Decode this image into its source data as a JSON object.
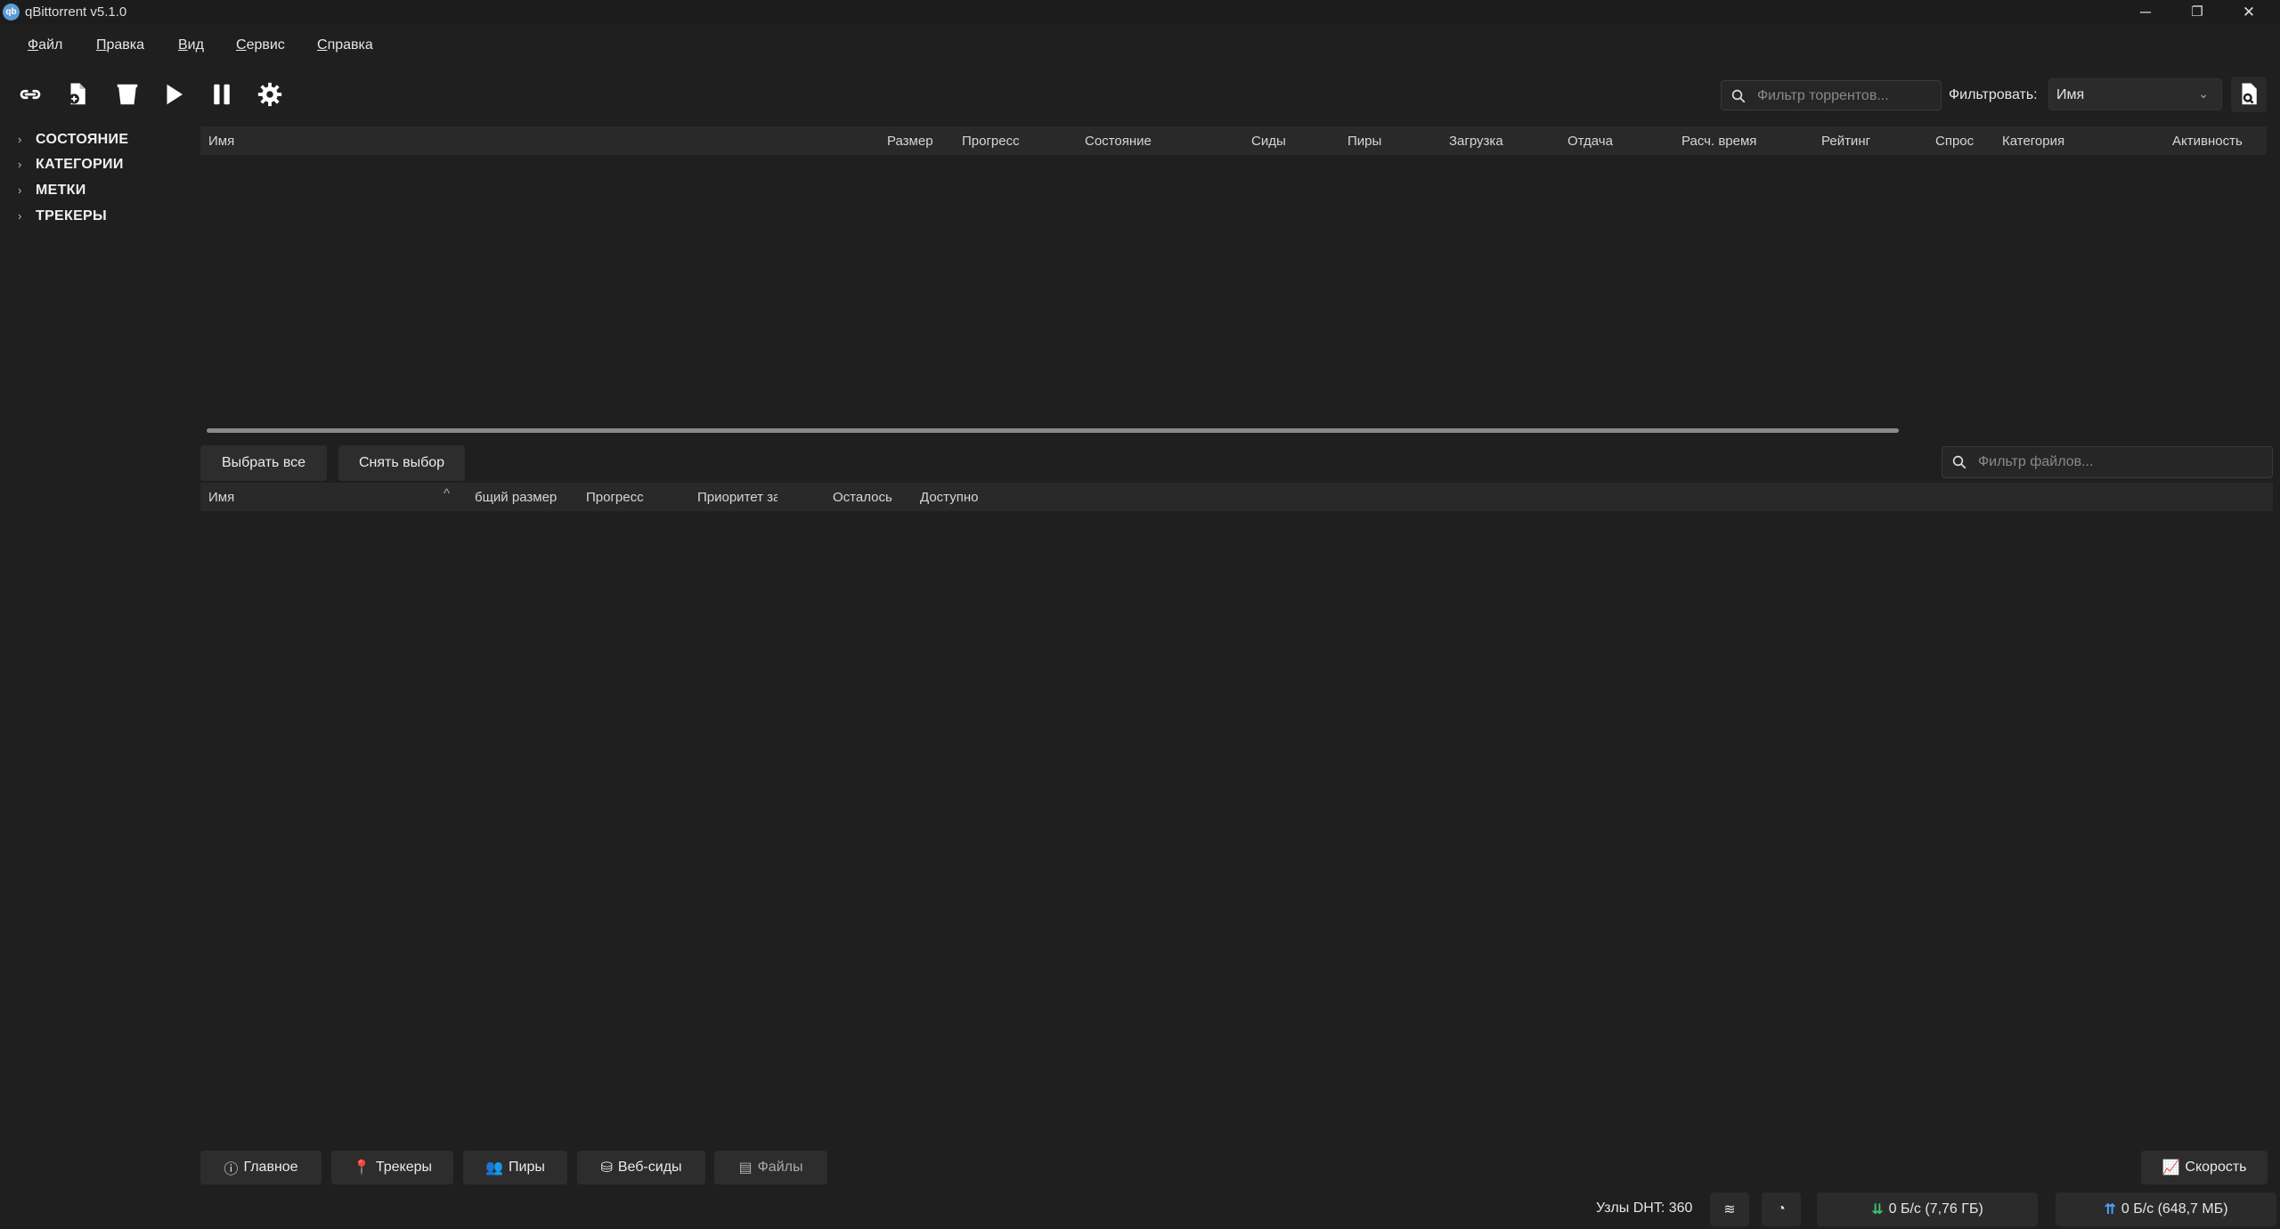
{
  "window": {
    "title": "qBittorrent v5.1.0",
    "controls": [
      "─",
      "❐",
      "✕"
    ]
  },
  "menu": [
    {
      "accel": "Ф",
      "rest": "айл"
    },
    {
      "accel": "П",
      "rest": "равка"
    },
    {
      "accel": "В",
      "rest": "ид"
    },
    {
      "accel": "С",
      "rest": "ервис"
    },
    {
      "accel": "С",
      "rest": "правка"
    }
  ],
  "toolbar": {
    "search_placeholder": "Фильтр торрентов...",
    "filter_label": "Фильтровать:",
    "filter_value": "Имя"
  },
  "sidebar": {
    "items": [
      {
        "label": "СОСТОЯНИЕ"
      },
      {
        "label": "КАТЕГОРИИ"
      },
      {
        "label": "МЕТКИ"
      },
      {
        "label": "ТРЕКЕРЫ"
      }
    ]
  },
  "torrent_table": {
    "columns": [
      "Имя",
      "Размер",
      "Прогресс",
      "Состояние",
      "Сиды",
      "Пиры",
      "Загрузка",
      "Отдача",
      "Расч. время",
      "Рейтинг",
      "Спрос",
      "Категория",
      "Активность"
    ]
  },
  "files_panel": {
    "select_all": "Выбрать все",
    "deselect": "Снять выбор",
    "search_placeholder": "Фильтр файлов...",
    "columns": [
      "Имя",
      "бщий размер",
      "Прогресс",
      "Приоритет за",
      "Осталось",
      "Доступно"
    ]
  },
  "tabs": [
    {
      "label": "Главное",
      "icon": "info-icon"
    },
    {
      "label": "Трекеры",
      "icon": "pin-icon"
    },
    {
      "label": "Пиры",
      "icon": "users-icon"
    },
    {
      "label": "Веб-сиды",
      "icon": "database-icon"
    },
    {
      "label": "Файлы",
      "icon": "file-icon"
    }
  ],
  "speed_button": "Скорость",
  "statusbar": {
    "dht": "Узлы DHT: 360",
    "download": "0 Б/с (7,76 ГБ)",
    "upload": "0 Б/с (648,7 МБ)"
  },
  "colors": {
    "background": "#1f1f1f",
    "header": "#292929",
    "down_accent": "#3ec46d",
    "up_accent": "#4da3ff"
  }
}
